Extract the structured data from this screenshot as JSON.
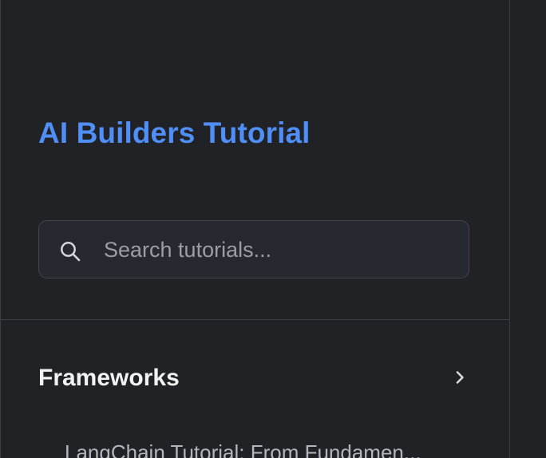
{
  "sidebar": {
    "title": "AI Builders Tutorial",
    "search": {
      "placeholder": "Search tutorials...",
      "value": ""
    },
    "sections": [
      {
        "label": "Frameworks",
        "items": [
          {
            "label": "LangChain Tutorial: From Fundamen..."
          }
        ]
      }
    ]
  },
  "icons": {
    "search": "search-icon",
    "section_toggle": "chevron-right-icon"
  },
  "colors": {
    "background": "#212225",
    "brand": "#4f8ff7",
    "border": "#3a3d44",
    "search_background": "#272930",
    "text_primary": "#f2f2f4",
    "text_muted": "#b2b5bc"
  }
}
